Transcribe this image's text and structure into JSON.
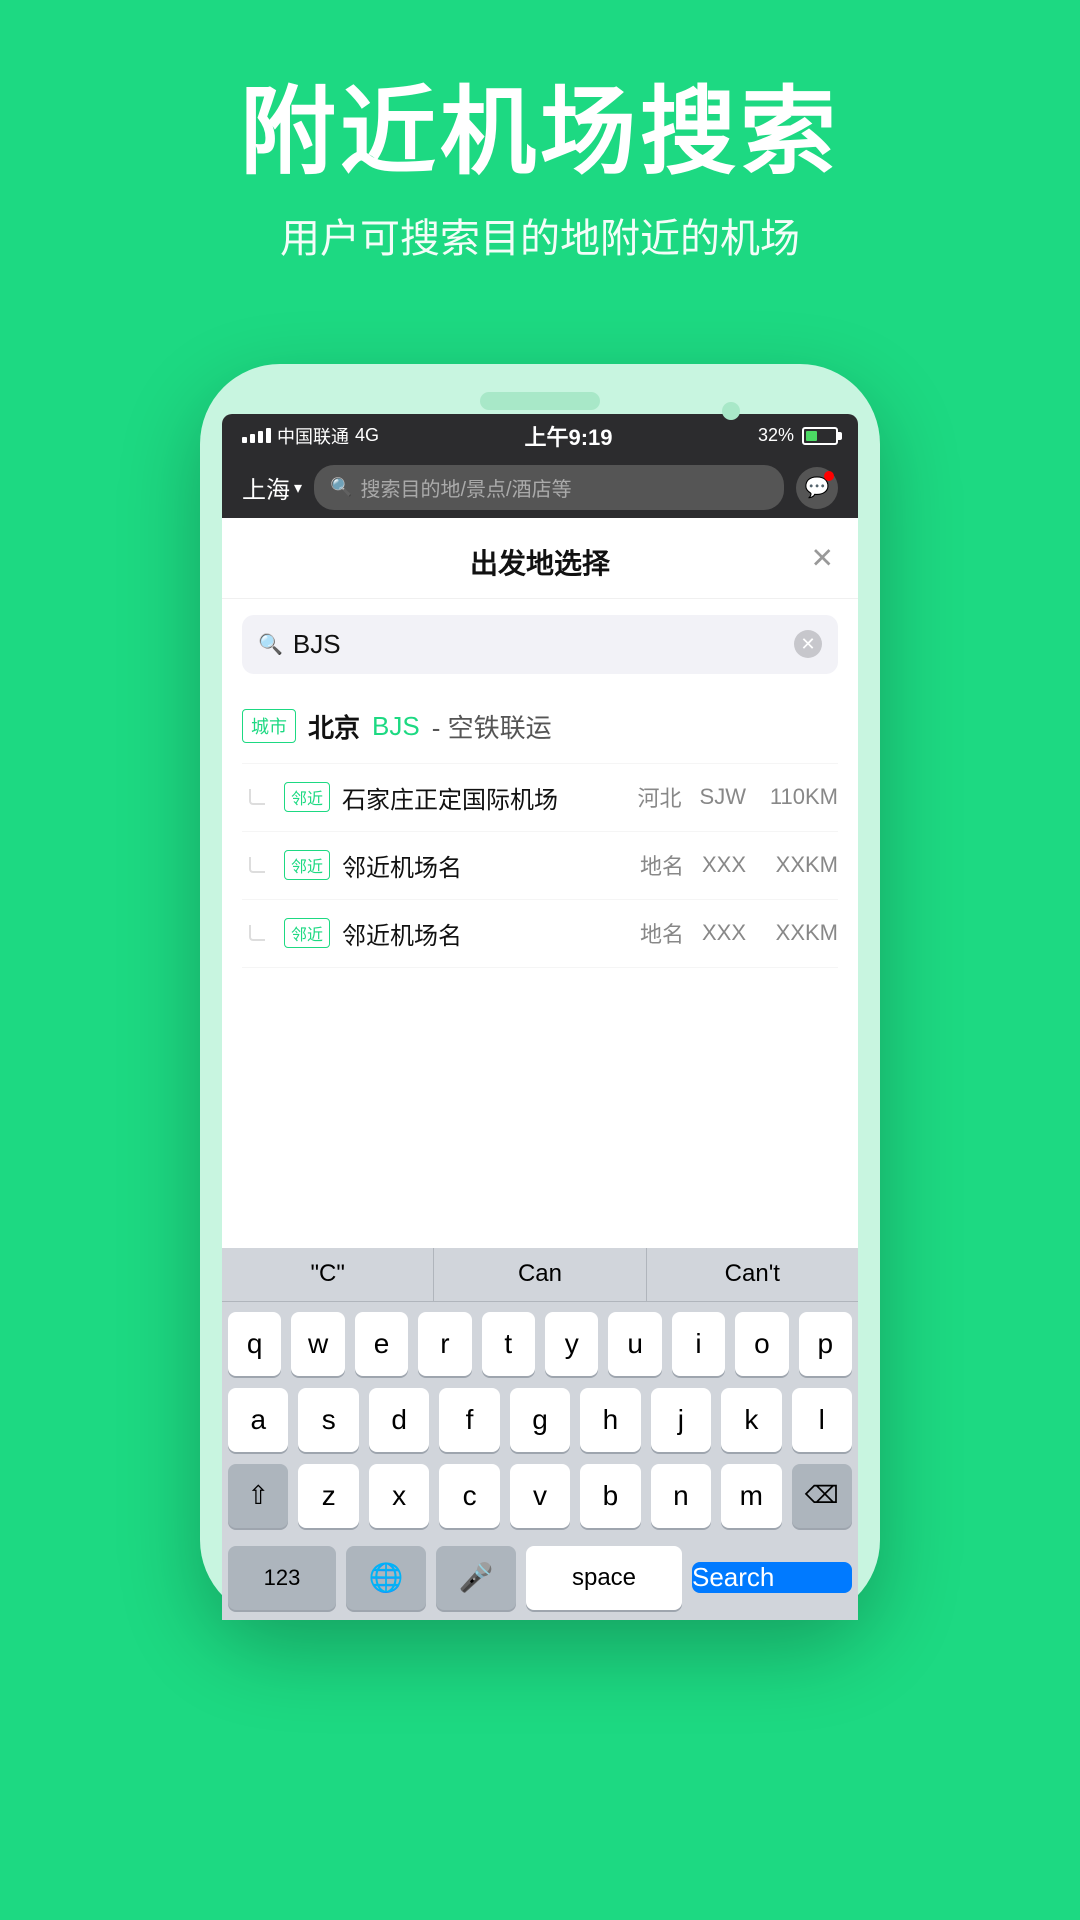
{
  "hero": {
    "title": "附近机场搜索",
    "subtitle": "用户可搜索目的地附近的机场"
  },
  "status_bar": {
    "carrier": "中国联通",
    "network": "4G",
    "time": "上午9:19",
    "battery_pct": "32%"
  },
  "app_header": {
    "city": "上海",
    "search_placeholder": "搜索目的地/景点/酒店等"
  },
  "modal": {
    "title": "出发地选择",
    "search_value": "BJS",
    "city_result": {
      "tag": "城市",
      "name": "北京",
      "code": "BJS",
      "suffix": "- 空铁联运"
    },
    "nearby_airports": [
      {
        "tag": "邻近",
        "name": "石家庄正定国际机场",
        "province": "河北",
        "code": "SJW",
        "distance": "110KM"
      },
      {
        "tag": "邻近",
        "name": "邻近机场名",
        "province": "地名",
        "code": "XXX",
        "distance": "XXKM"
      },
      {
        "tag": "邻近",
        "name": "邻近机场名",
        "province": "地名",
        "code": "XXX",
        "distance": "XXKM"
      }
    ]
  },
  "keyboard": {
    "suggestions": [
      {
        "label": "“C”"
      },
      {
        "label": "Can"
      },
      {
        "label": "Can’t"
      }
    ],
    "rows": [
      [
        "q",
        "w",
        "e",
        "r",
        "t",
        "y",
        "u",
        "i",
        "o",
        "p"
      ],
      [
        "a",
        "s",
        "d",
        "f",
        "g",
        "h",
        "j",
        "k",
        "l"
      ],
      [
        "z",
        "x",
        "c",
        "v",
        "b",
        "n",
        "m"
      ]
    ],
    "bottom": {
      "num_label": "123",
      "space_label": "space",
      "search_label": "Search"
    }
  }
}
